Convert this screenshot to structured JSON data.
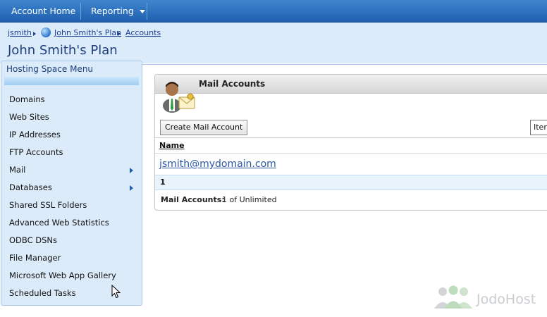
{
  "topnav": {
    "account_home": "Account Home",
    "reporting": "Reporting"
  },
  "breadcrumb": {
    "items": [
      "jsmith",
      "John Smith's Plan",
      "Accounts"
    ]
  },
  "page_title": "John Smith's Plan",
  "sidebar": {
    "title": "Hosting Space Menu",
    "items": [
      {
        "label": "Domains",
        "has_submenu": false
      },
      {
        "label": "Web Sites",
        "has_submenu": false
      },
      {
        "label": "IP Addresses",
        "has_submenu": false
      },
      {
        "label": "FTP Accounts",
        "has_submenu": false
      },
      {
        "label": "Mail",
        "has_submenu": true
      },
      {
        "label": "Databases",
        "has_submenu": true
      },
      {
        "label": "Shared SSL Folders",
        "has_submenu": false
      },
      {
        "label": "Advanced Web Statistics",
        "has_submenu": false
      },
      {
        "label": "ODBC DSNs",
        "has_submenu": false
      },
      {
        "label": "File Manager",
        "has_submenu": false
      },
      {
        "label": "Microsoft Web App Gallery",
        "has_submenu": false
      },
      {
        "label": "Scheduled Tasks",
        "has_submenu": false
      }
    ]
  },
  "mail_panel": {
    "title": "Mail Accounts",
    "create_button": "Create Mail Account",
    "items_box": "Iter",
    "column_name": "Name",
    "rows": [
      "jsmith@mydomain.com"
    ],
    "page_number": "1",
    "footer_label": "Mail Accounts:",
    "footer_value": "1 of Unlimited"
  },
  "watermark": "JodoHost",
  "colors": {
    "nav_blue": "#2a6fbf",
    "band": "#dcebfa",
    "link": "#2a57a6"
  }
}
